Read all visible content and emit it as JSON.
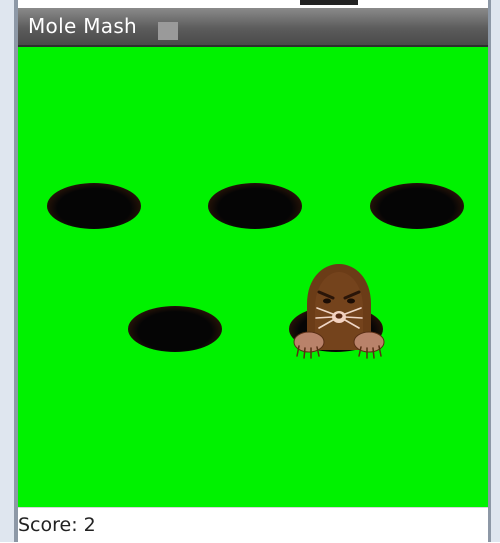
{
  "app": {
    "title": "Mole Mash"
  },
  "game": {
    "holes": [
      {
        "id": 1,
        "occupied": false
      },
      {
        "id": 2,
        "occupied": false
      },
      {
        "id": 3,
        "occupied": false
      },
      {
        "id": 4,
        "occupied": false
      },
      {
        "id": 5,
        "occupied": true
      }
    ]
  },
  "score": {
    "text": "Score: 2"
  },
  "colors": {
    "field": "#00f200",
    "mole": "#6b3c17",
    "titlebar": "#5c5c5c"
  }
}
